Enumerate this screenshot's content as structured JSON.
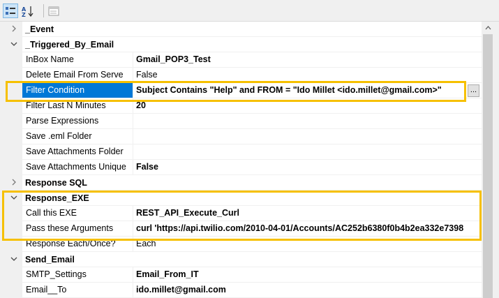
{
  "toolbar": {
    "buttons": [
      {
        "icon": "categorized-view-icon",
        "active": true
      },
      {
        "icon": "alphabetical-sort-icon",
        "active": false
      },
      {
        "icon": "property-pages-icon",
        "active": false
      }
    ]
  },
  "categories": {
    "event": {
      "label": "_Event",
      "expanded": false
    },
    "triggered": {
      "label": "_Triggered_By_Email",
      "expanded": true
    },
    "response_sql": {
      "label": "Response SQL",
      "expanded": false
    },
    "response_exe": {
      "label": "Response_EXE",
      "expanded": true
    },
    "send_email": {
      "label": "Send_Email",
      "expanded": true
    }
  },
  "properties": {
    "inbox_name": {
      "name": "InBox Name",
      "value": "Gmail_POP3_Test"
    },
    "delete_email": {
      "name": "Delete Email From Serve",
      "value": "False"
    },
    "filter_condition": {
      "name": "Filter Condition",
      "value": "Subject Contains \"Help\" and FROM = \"Ido Millet <ido.millet@gmail.com>\""
    },
    "filter_last_n": {
      "name": "Filter Last N Minutes",
      "value": "20"
    },
    "parse_expressions": {
      "name": "Parse Expressions",
      "value": ""
    },
    "save_eml": {
      "name": "Save .eml Folder",
      "value": ""
    },
    "save_attach_folder": {
      "name": "Save Attachments Folder",
      "value": ""
    },
    "save_attach_unique": {
      "name": "Save Attachments Unique",
      "value": "False"
    },
    "call_exe": {
      "name": "Call this EXE",
      "value": "REST_API_Execute_Curl"
    },
    "pass_args": {
      "name": "Pass these Arguments",
      "value": "curl 'https://api.twilio.com/2010-04-01/Accounts/AC252b6380f0b4b2ea332e7398"
    },
    "response_each": {
      "name": "Response Each/Once?",
      "value": "Each"
    },
    "smtp_settings": {
      "name": "SMTP_Settings",
      "value": "Email_From_IT"
    },
    "email_to": {
      "name": "Email__To",
      "value": "ido.millet@gmail.com"
    }
  },
  "ellipsis_label": "...",
  "colors": {
    "highlight": "#f6c000",
    "selection": "#0078d7",
    "gutter": "#f0f0f0"
  }
}
